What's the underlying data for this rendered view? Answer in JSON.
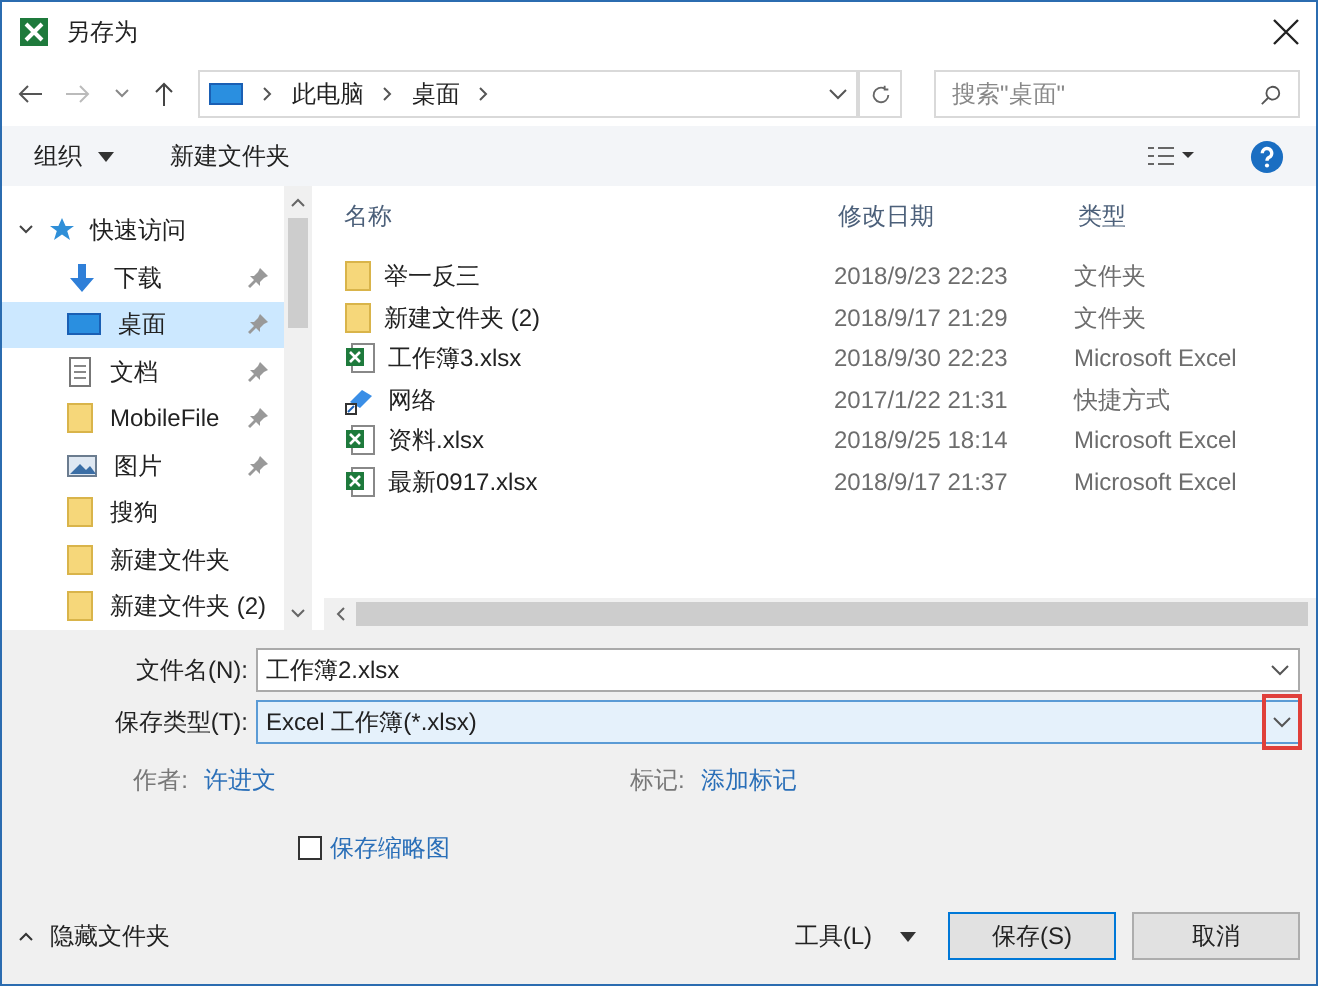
{
  "window": {
    "title": "另存为"
  },
  "nav": {
    "path": [
      "此电脑",
      "桌面"
    ],
    "search_placeholder": "搜索\"桌面\""
  },
  "toolbar": {
    "organize": "组织",
    "new_folder": "新建文件夹"
  },
  "sidebar": {
    "header": {
      "label": "快速访问",
      "expanded": true
    },
    "items": [
      {
        "label": "下载",
        "kind": "download",
        "pinned": true,
        "selected": false
      },
      {
        "label": "桌面",
        "kind": "desktop",
        "pinned": true,
        "selected": true
      },
      {
        "label": "文档",
        "kind": "document",
        "pinned": true,
        "selected": false
      },
      {
        "label": "MobileFile",
        "kind": "folder",
        "pinned": true,
        "selected": false
      },
      {
        "label": "图片",
        "kind": "pictures",
        "pinned": true,
        "selected": false
      },
      {
        "label": "搜狗",
        "kind": "folder",
        "pinned": false,
        "selected": false
      },
      {
        "label": "新建文件夹",
        "kind": "folder",
        "pinned": false,
        "selected": false
      },
      {
        "label": "新建文件夹 (2)",
        "kind": "folder",
        "pinned": false,
        "selected": false
      }
    ]
  },
  "table": {
    "columns": [
      "名称",
      "修改日期",
      "类型"
    ],
    "rows": [
      {
        "name": "举一反三",
        "date": "2018/9/23 22:23",
        "type": "文件夹",
        "kind": "folder"
      },
      {
        "name": "新建文件夹 (2)",
        "date": "2018/9/17 21:29",
        "type": "文件夹",
        "kind": "folder"
      },
      {
        "name": "工作簿3.xlsx",
        "date": "2018/9/30 22:23",
        "type": "Microsoft Excel",
        "kind": "excel"
      },
      {
        "name": "网络",
        "date": "2017/1/22 21:31",
        "type": "快捷方式",
        "kind": "shortcut"
      },
      {
        "name": "资料.xlsx",
        "date": "2018/9/25 18:14",
        "type": "Microsoft Excel",
        "kind": "excel"
      },
      {
        "name": "最新0917.xlsx",
        "date": "2018/9/17 21:37",
        "type": "Microsoft Excel",
        "kind": "excel"
      }
    ]
  },
  "form": {
    "filename_label": "文件名(N):",
    "filename": "工作簿2.xlsx",
    "type_label": "保存类型(T):",
    "type": "Excel 工作簿(*.xlsx)",
    "author_label": "作者:",
    "author": "许进文",
    "tags_label": "标记:",
    "tags": "添加标记",
    "thumbnail": {
      "label": "保存缩略图",
      "checked": false
    }
  },
  "footer": {
    "hide_folders": "隐藏文件夹",
    "tools": "工具(L)",
    "buttons": [
      "保存(S)",
      "取消"
    ]
  }
}
